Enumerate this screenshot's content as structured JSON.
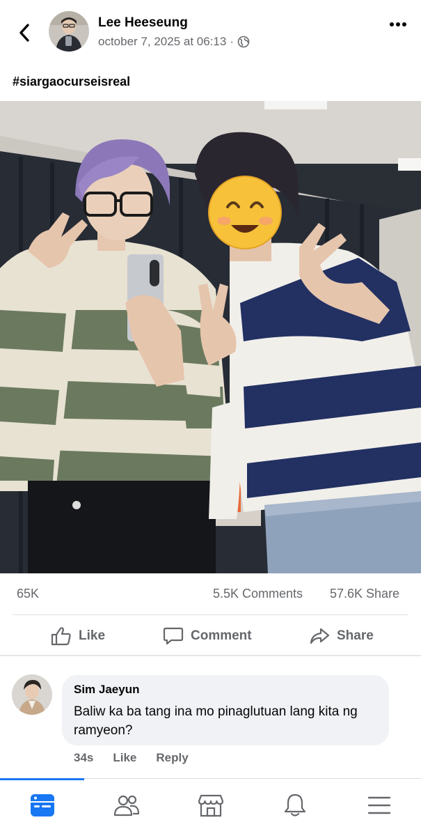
{
  "post": {
    "author": "Lee Heeseung",
    "timestamp": "october 7, 2025 at 06:13",
    "separator": "·",
    "caption": "#siargaocurseisreal"
  },
  "stats": {
    "reactions": "65K",
    "comments": "5.5K Comments",
    "shares": "57.6K Share"
  },
  "actions": {
    "like": "Like",
    "comment": "Comment",
    "share": "Share"
  },
  "comment": {
    "author": "Sim Jaeyun",
    "text": "Baliw ka ba tang ina mo pinaglutuan lang kita ng ramyeon?",
    "time": "34s",
    "like": "Like",
    "reply": "Reply"
  },
  "tabs": [
    {
      "name": "home",
      "active": true
    },
    {
      "name": "friends",
      "active": false
    },
    {
      "name": "marketplace",
      "active": false
    },
    {
      "name": "notifications",
      "active": false
    },
    {
      "name": "menu",
      "active": false
    }
  ],
  "colors": {
    "accent": "#1877f2",
    "secondary_text": "#65676b",
    "bubble": "#f0f2f5"
  },
  "icons": [
    "back-arrow-icon",
    "more-dots-icon",
    "globe-icon",
    "thumbs-up-icon",
    "comment-bubble-icon",
    "share-arrow-icon",
    "home-feed-icon",
    "friends-icon",
    "marketplace-icon",
    "bell-icon",
    "menu-icon"
  ]
}
